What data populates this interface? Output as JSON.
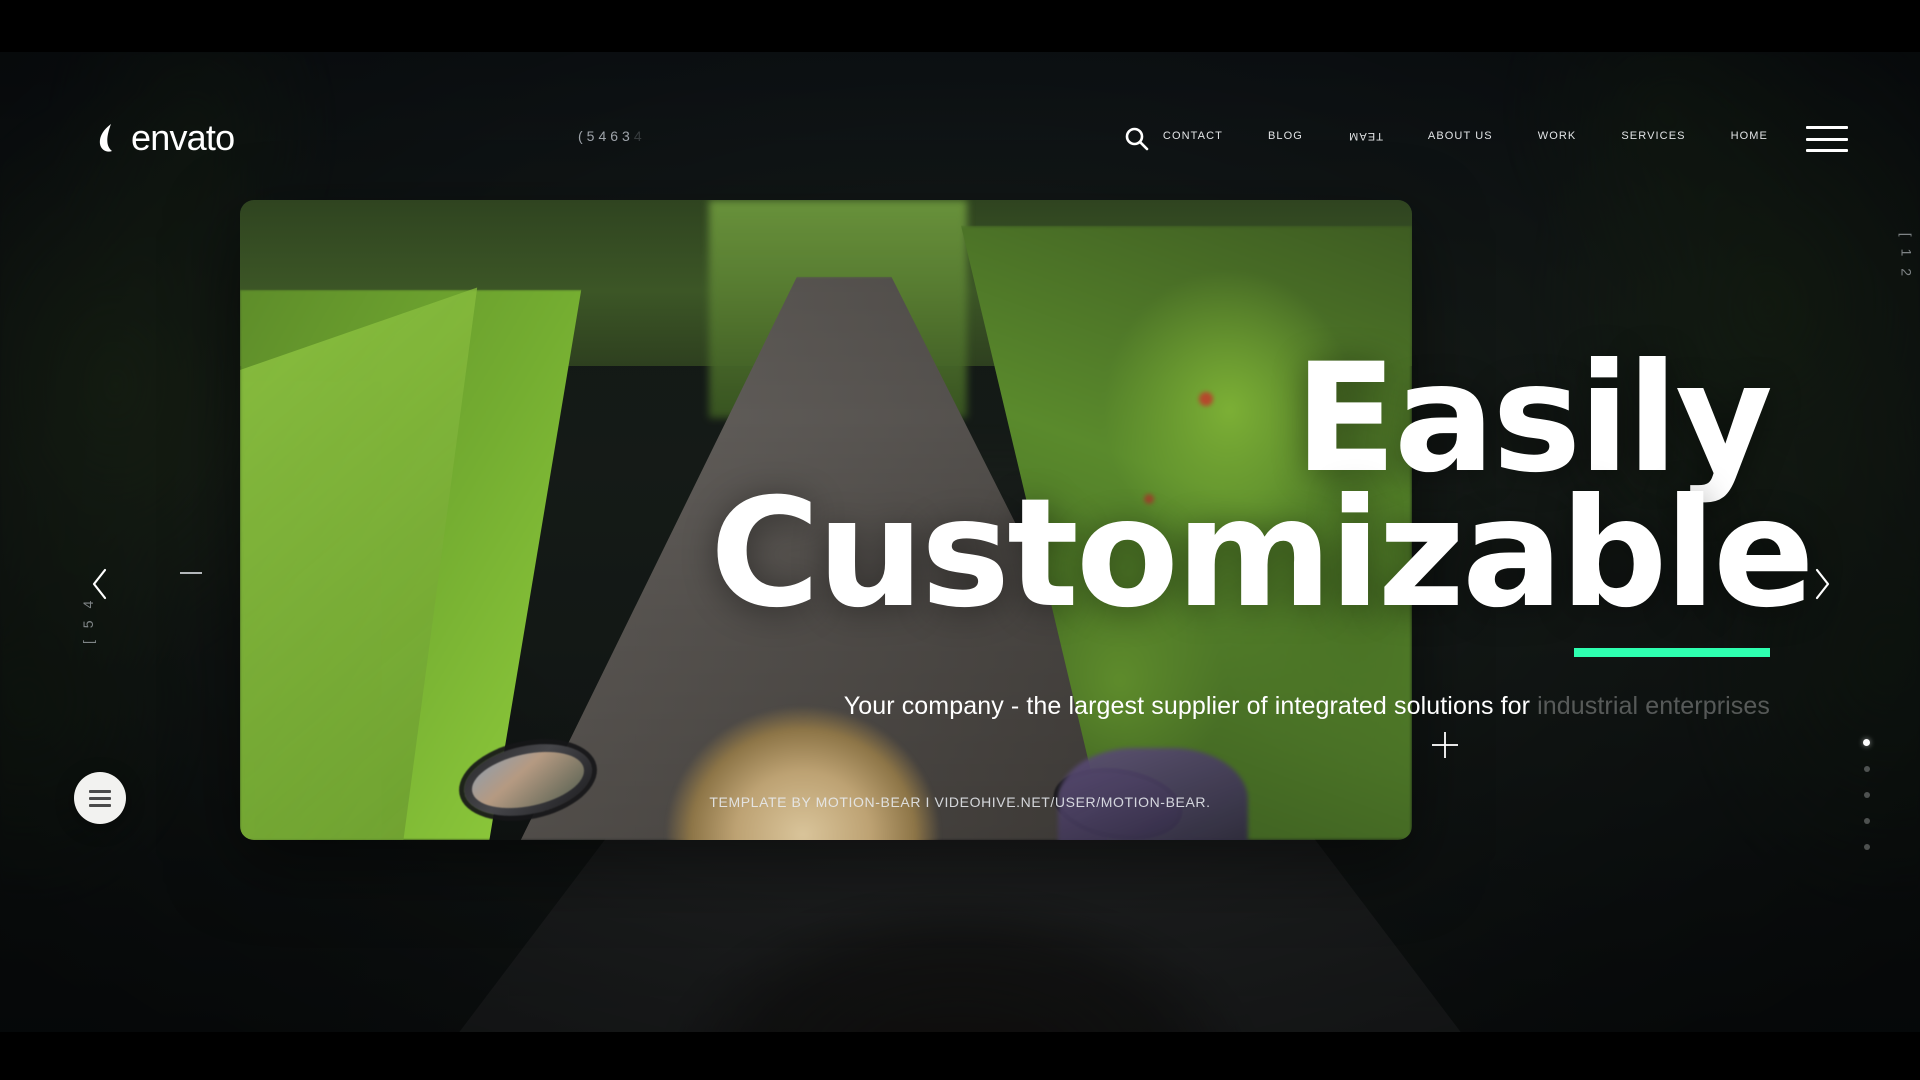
{
  "brand": {
    "name": "envato",
    "logo_icon": "envato-leaf-icon"
  },
  "header": {
    "counter": "(5463",
    "counter_fade": "4",
    "search_icon": "search-icon",
    "menu_icon": "hamburger-menu-icon",
    "nav": [
      {
        "label": "CONTACT",
        "mirrored": false
      },
      {
        "label": "BLOG",
        "mirrored": false
      },
      {
        "label": "TEAM",
        "mirrored": true
      },
      {
        "label": "ABOUT US",
        "mirrored": false
      },
      {
        "label": "WORK",
        "mirrored": false
      },
      {
        "label": "SERVICES",
        "mirrored": false
      },
      {
        "label": "HOME",
        "mirrored": false
      }
    ]
  },
  "hero": {
    "line1": "Easily",
    "line2": "Customizable",
    "subtitle_bright": "Your company - the largest supplier of integrated solutions for",
    "subtitle_dim": "industrial enterprises",
    "accent_color": "#2EFFB0"
  },
  "slider": {
    "prev_icon": "chevron-left-icon",
    "next_icon": "chevron-right-icon",
    "dash_marker": "—",
    "dots": [
      {
        "active": true
      },
      {
        "active": false
      },
      {
        "active": false
      },
      {
        "active": false
      },
      {
        "active": false
      }
    ]
  },
  "side_labels": {
    "right": "[ 1 2",
    "left": "[ 5 4"
  },
  "controls": {
    "fab_icon": "hamburger-menu-icon",
    "plus_icon": "plus-icon"
  },
  "footer": {
    "credit": "TEMPLATE BY MOTION-BEAR  I  VIDEOHIVE.NET/USER/MOTION-BEAR."
  }
}
